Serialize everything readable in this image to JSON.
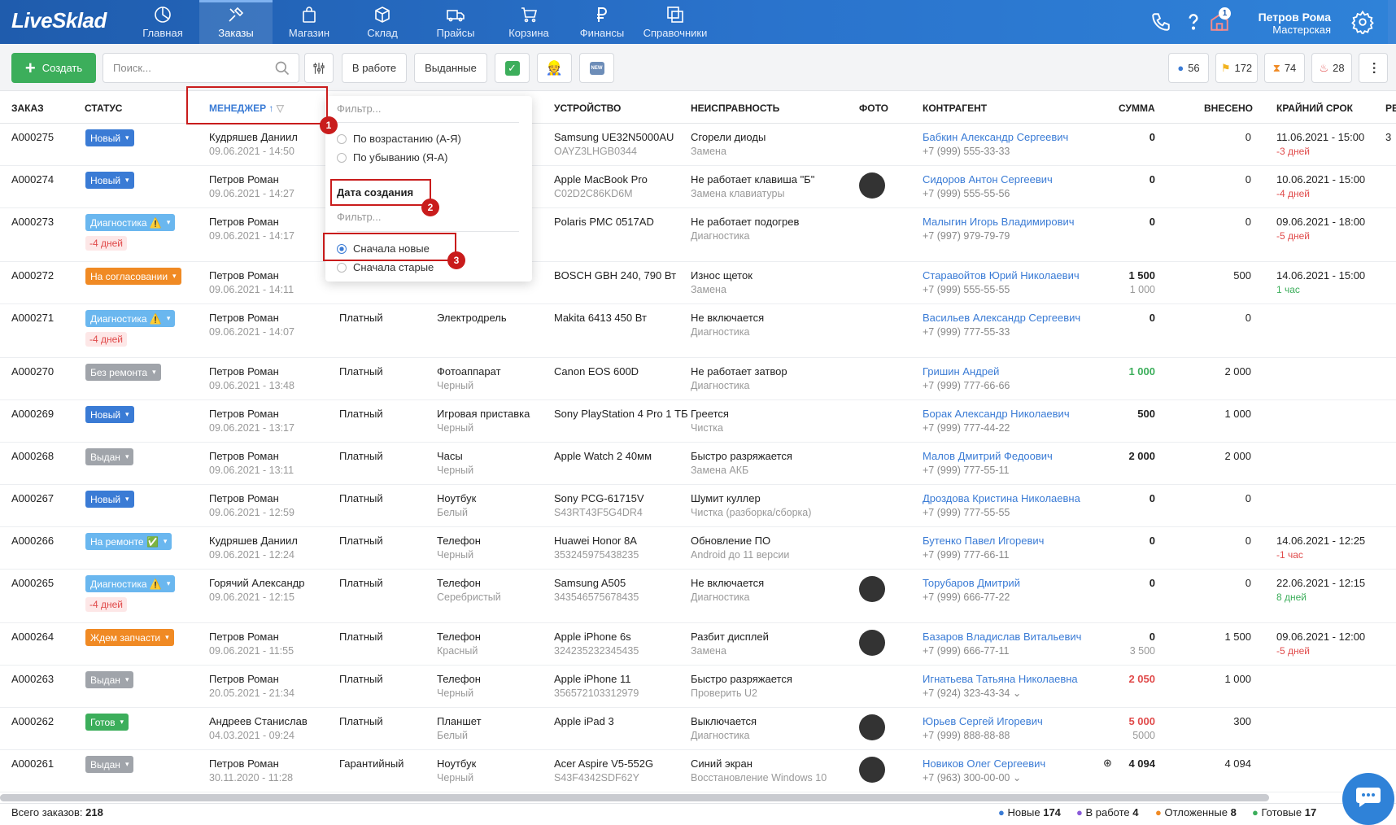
{
  "app": {
    "logo": "LiveSklad"
  },
  "nav": [
    {
      "label": "Главная",
      "icon": "chart-pie-icon",
      "active": false
    },
    {
      "label": "Заказы",
      "icon": "tools-icon",
      "active": true
    },
    {
      "label": "Магазин",
      "icon": "shop-bag-icon",
      "active": false
    },
    {
      "label": "Склад",
      "icon": "box-icon",
      "active": false
    },
    {
      "label": "Прайсы",
      "icon": "truck-icon",
      "active": false
    },
    {
      "label": "Корзина",
      "icon": "cart-icon",
      "active": false
    },
    {
      "label": "Финансы",
      "icon": "ruble-icon",
      "active": false
    },
    {
      "label": "Справочники",
      "icon": "copy-icon",
      "active": false
    }
  ],
  "topright": {
    "notif_count": "1",
    "user_name": "Петров Рома",
    "user_role": "Мастерская"
  },
  "toolbar": {
    "create_label": "Создать",
    "search_placeholder": "Поиск...",
    "in_work_label": "В работе",
    "issued_label": "Выданные",
    "counters": [
      {
        "icon": "user-icon",
        "value": "56",
        "color": "#3a7bd5"
      },
      {
        "icon": "flag-icon",
        "value": "172",
        "color": "#f2b320"
      },
      {
        "icon": "hourglass-icon",
        "value": "74",
        "color": "#f08a24"
      },
      {
        "icon": "fire-icon",
        "value": "28",
        "color": "#e04a4a"
      }
    ]
  },
  "columns": {
    "order": "ЗАКАЗ",
    "status": "СТАТУС",
    "manager": "МЕНЕДЖЕР",
    "device": "УСТРОЙСТВО",
    "fault": "НЕИСПРАВНОСТЬ",
    "photo": "ФОТО",
    "client": "КОНТРАГЕНТ",
    "sum": "СУММА",
    "paid": "ВНЕСЕНО",
    "deadline": "КРАЙНИЙ СРОК",
    "more": "РЕ"
  },
  "dropdown": {
    "filter1": "Фильтр...",
    "asc": "По возрастанию (А-Я)",
    "desc": "По убыванию (Я-А)",
    "created_head": "Дата создания",
    "filter2": "Фильтр...",
    "newest": "Сначала новые",
    "oldest": "Сначала старые"
  },
  "markers": [
    "1",
    "2",
    "3"
  ],
  "orders": [
    {
      "id": "A000275",
      "status": "Новый",
      "status_color": "#3a7bd5",
      "warn": false,
      "late": "",
      "manager": "Кудряшев Даниил",
      "date": "09.06.2021 - 14:50",
      "type": "",
      "kind": "",
      "color": "",
      "device": "Samsung UE32N5000AU",
      "serial": "OAYZ3LHGB0344",
      "fault": "Сгорели диоды",
      "work": "Замена",
      "photo": false,
      "client": "Бабкин Александр Сергеевич",
      "phone": "+7 (999) 555-33-33",
      "sum": "0",
      "sum2": "",
      "sum_color": "",
      "paid": "0",
      "deadline": "11.06.2021 - 15:00",
      "dl_note": "-3 дней",
      "dl_color": "red",
      "extra": "3"
    },
    {
      "id": "A000274",
      "status": "Новый",
      "status_color": "#3a7bd5",
      "warn": false,
      "late": "",
      "manager": "Петров Роман",
      "date": "09.06.2021 - 14:27",
      "type": "",
      "kind": "",
      "color": "",
      "device": "Apple MacBook Pro",
      "serial": "C02D2C86KD6M",
      "fault": "Не работает клавиша \"Б\"",
      "work": "Замена клавиатуры",
      "photo": true,
      "client": "Сидоров Антон Сергеевич",
      "phone": "+7 (999) 555-55-56",
      "sum": "0",
      "sum2": "",
      "sum_color": "",
      "paid": "0",
      "deadline": "10.06.2021 - 15:00",
      "dl_note": "-4 дней",
      "dl_color": "red",
      "extra": ""
    },
    {
      "id": "A000273",
      "status": "Диагностика ⚠️",
      "status_color": "#6ab7ef",
      "warn": true,
      "late": "-4 дней",
      "manager": "Петров Роман",
      "date": "09.06.2021 - 14:17",
      "type": "",
      "kind": "",
      "color": "",
      "device": "Polaris PMC 0517AD",
      "serial": "",
      "fault": "Не работает подогрев",
      "work": "Диагностика",
      "photo": false,
      "client": "Малыгин Игорь Владимирович",
      "phone": "+7 (997) 979-79-79",
      "sum": "0",
      "sum2": "",
      "sum_color": "",
      "paid": "0",
      "deadline": "09.06.2021 - 18:00",
      "dl_note": "-5 дней",
      "dl_color": "red",
      "extra": ""
    },
    {
      "id": "A000272",
      "status": "На согласовании",
      "status_color": "#f08a24",
      "warn": false,
      "late": "",
      "manager": "Петров Роман",
      "date": "09.06.2021 - 14:11",
      "type": "",
      "kind": "",
      "color": "",
      "device": "BOSCH GBH 240, 790 Вт",
      "serial": "",
      "fault": "Износ щеток",
      "work": "Замена",
      "photo": false,
      "client": "Старавойтов Юрий Николаевич",
      "phone": "+7 (999) 555-55-55",
      "sum": "1 500",
      "sum2": "1 000",
      "sum_color": "",
      "paid": "500",
      "deadline": "14.06.2021 - 15:00",
      "dl_note": "1 час",
      "dl_color": "green",
      "extra": ""
    },
    {
      "id": "A000271",
      "status": "Диагностика ⚠️",
      "status_color": "#6ab7ef",
      "warn": true,
      "late": "-4 дней",
      "manager": "Петров Роман",
      "date": "09.06.2021 - 14:07",
      "type": "Платный",
      "kind": "Электродрель",
      "color": "",
      "device": "Makita 6413 450 Вт",
      "serial": "",
      "fault": "Не включается",
      "work": "Диагностика",
      "photo": false,
      "client": "Васильев Александр Сергеевич",
      "phone": "+7 (999) 777-55-33",
      "sum": "0",
      "sum2": "",
      "sum_color": "",
      "paid": "0",
      "deadline": "",
      "dl_note": "",
      "dl_color": "",
      "extra": ""
    },
    {
      "id": "A000270",
      "status": "Без ремонта",
      "status_color": "#a0a4aa",
      "warn": false,
      "late": "",
      "manager": "Петров Роман",
      "date": "09.06.2021 - 13:48",
      "type": "Платный",
      "kind": "Фотоаппарат",
      "color": "Черный",
      "device": "Canon EOS 600D",
      "serial": "",
      "fault": "Не работает затвор",
      "work": "Диагностика",
      "photo": false,
      "client": "Гришин Андрей",
      "phone": "+7 (999) 777-66-66",
      "sum": "1 000",
      "sum2": "",
      "sum_color": "green",
      "paid": "2 000",
      "deadline": "",
      "dl_note": "",
      "dl_color": "",
      "extra": ""
    },
    {
      "id": "A000269",
      "status": "Новый",
      "status_color": "#3a7bd5",
      "warn": false,
      "late": "",
      "manager": "Петров Роман",
      "date": "09.06.2021 - 13:17",
      "type": "Платный",
      "kind": "Игровая приставка",
      "color": "Черный",
      "device": "Sony PlayStation 4 Pro 1 ТБ",
      "serial": "",
      "fault": "Греется",
      "work": "Чистка",
      "photo": false,
      "client": "Борак Александр Николаевич",
      "phone": "+7 (999) 777-44-22",
      "sum": "500",
      "sum2": "",
      "sum_color": "",
      "paid": "1 000",
      "deadline": "",
      "dl_note": "",
      "dl_color": "",
      "extra": ""
    },
    {
      "id": "A000268",
      "status": "Выдан",
      "status_color": "#a0a4aa",
      "warn": false,
      "late": "",
      "manager": "Петров Роман",
      "date": "09.06.2021 - 13:11",
      "type": "Платный",
      "kind": "Часы",
      "color": "Черный",
      "device": "Apple Watch 2 40мм",
      "serial": "",
      "fault": "Быстро разряжается",
      "work": "Замена АКБ",
      "photo": false,
      "client": "Малов Дмитрий Федоович",
      "phone": "+7 (999) 777-55-11",
      "sum": "2 000",
      "sum2": "",
      "sum_color": "",
      "paid": "2 000",
      "deadline": "",
      "dl_note": "",
      "dl_color": "",
      "extra": ""
    },
    {
      "id": "A000267",
      "status": "Новый",
      "status_color": "#3a7bd5",
      "warn": false,
      "late": "",
      "manager": "Петров Роман",
      "date": "09.06.2021 - 12:59",
      "type": "Платный",
      "kind": "Ноутбук",
      "color": "Белый",
      "device": "Sony PCG-61715V",
      "serial": "S43RT43F5G4DR4",
      "fault": "Шумит куллер",
      "work": "Чистка (разборка/сборка)",
      "photo": false,
      "client": "Дроздова Кристина Николаевна",
      "phone": "+7 (999) 777-55-55",
      "sum": "0",
      "sum2": "",
      "sum_color": "",
      "paid": "0",
      "deadline": "",
      "dl_note": "",
      "dl_color": "",
      "extra": ""
    },
    {
      "id": "A000266",
      "status": "На ремонте ✅",
      "status_color": "#6ab7ef",
      "warn": false,
      "late": "",
      "manager": "Кудряшев Даниил",
      "date": "09.06.2021 - 12:24",
      "type": "Платный",
      "kind": "Телефон",
      "color": "Черный",
      "device": "Huawei Honor 8A",
      "serial": "353245975438235",
      "fault": "Обновление ПО",
      "work": "Android до 11 версии",
      "photo": false,
      "client": "Бутенко Павел Игоревич",
      "phone": "+7 (999) 777-66-11",
      "sum": "0",
      "sum2": "",
      "sum_color": "",
      "paid": "0",
      "deadline": "14.06.2021 - 12:25",
      "dl_note": "-1 час",
      "dl_color": "red",
      "extra": ""
    },
    {
      "id": "A000265",
      "status": "Диагностика ⚠️",
      "status_color": "#6ab7ef",
      "warn": true,
      "late": "-4 дней",
      "manager": "Горячий Александр",
      "date": "09.06.2021 - 12:15",
      "type": "Платный",
      "kind": "Телефон",
      "color": "Серебристый",
      "device": "Samsung A505",
      "serial": "343546575678435",
      "fault": "Не включается",
      "work": "Диагностика",
      "photo": true,
      "client": "Торубаров Дмитрий",
      "phone": "+7 (999) 666-77-22",
      "sum": "0",
      "sum2": "",
      "sum_color": "",
      "paid": "0",
      "deadline": "22.06.2021 - 12:15",
      "dl_note": "8 дней",
      "dl_color": "green",
      "extra": ""
    },
    {
      "id": "A000264",
      "status": "Ждем запчасти",
      "status_color": "#f08a24",
      "warn": false,
      "late": "",
      "manager": "Петров Роман",
      "date": "09.06.2021 - 11:55",
      "type": "Платный",
      "kind": "Телефон",
      "color": "Красный",
      "device": "Apple iPhone 6s",
      "serial": "324235232345435",
      "fault": "Разбит дисплей",
      "work": "Замена",
      "photo": true,
      "client": "Базаров Владислав Витальевич",
      "phone": "+7 (999) 666-77-11",
      "sum": "0",
      "sum2": "3 500",
      "sum_color": "",
      "paid": "1 500",
      "deadline": "09.06.2021 - 12:00",
      "dl_note": "-5 дней",
      "dl_color": "red",
      "extra": ""
    },
    {
      "id": "A000263",
      "status": "Выдан",
      "status_color": "#a0a4aa",
      "warn": false,
      "late": "",
      "manager": "Петров Роман",
      "date": "20.05.2021 - 21:34",
      "type": "Платный",
      "kind": "Телефон",
      "color": "Черный",
      "device": "Apple iPhone 11",
      "serial": "356572103312979",
      "fault": "Быстро разряжается",
      "work": "Проверить U2",
      "photo": false,
      "client": "Игнатьева Татьяна Николаевна",
      "phone": "+7 (924) 323-43-34 ⌄",
      "sum": "2 050",
      "sum2": "",
      "sum_color": "red",
      "paid": "1 000",
      "deadline": "",
      "dl_note": "",
      "dl_color": "",
      "extra": ""
    },
    {
      "id": "A000262",
      "status": "Готов",
      "status_color": "#3cae5b",
      "warn": false,
      "late": "",
      "manager": "Андреев Станислав",
      "date": "04.03.2021 - 09:24",
      "type": "Платный",
      "kind": "Планшет",
      "color": "Белый",
      "device": "Apple iPad 3",
      "serial": "",
      "fault": "Выключается",
      "work": "Диагностика",
      "photo": true,
      "client": "Юрьев Сергей Игоревич",
      "phone": "+7 (999) 888-88-88",
      "sum": "5 000",
      "sum2": "5000",
      "sum_color": "red",
      "paid": "300",
      "deadline": "",
      "dl_note": "",
      "dl_color": "",
      "extra": ""
    },
    {
      "id": "A000261",
      "status": "Выдан",
      "status_color": "#a0a4aa",
      "warn": false,
      "late": "",
      "manager": "Петров Роман",
      "date": "30.11.2020 - 11:28",
      "type": "Гарантийный",
      "kind": "Ноутбук",
      "color": "Черный",
      "device": "Acer Aspire V5-552G",
      "serial": "S43F4342SDF62Y",
      "fault": "Синий экран",
      "work": "Восстановление Windows 10",
      "photo": true,
      "client": "Новиков Олег Сергеевич",
      "phone": "+7 (963) 300-00-00 ⌄",
      "sum": "4 094",
      "sum2": "",
      "sum_color": "",
      "paid": "4 094",
      "deadline": "",
      "dl_note": "",
      "dl_color": "",
      "extra": ""
    }
  ],
  "footer": {
    "total_label": "Всего заказов:",
    "total": "218",
    "stats": [
      {
        "label": "Новые",
        "value": "174",
        "color": "#3a7bd5"
      },
      {
        "label": "В работе",
        "value": "4",
        "color": "#8a5ad9"
      },
      {
        "label": "Отложенные",
        "value": "8",
        "color": "#f08a24"
      },
      {
        "label": "Готовые",
        "value": "17",
        "color": "#3cae5b"
      }
    ]
  }
}
